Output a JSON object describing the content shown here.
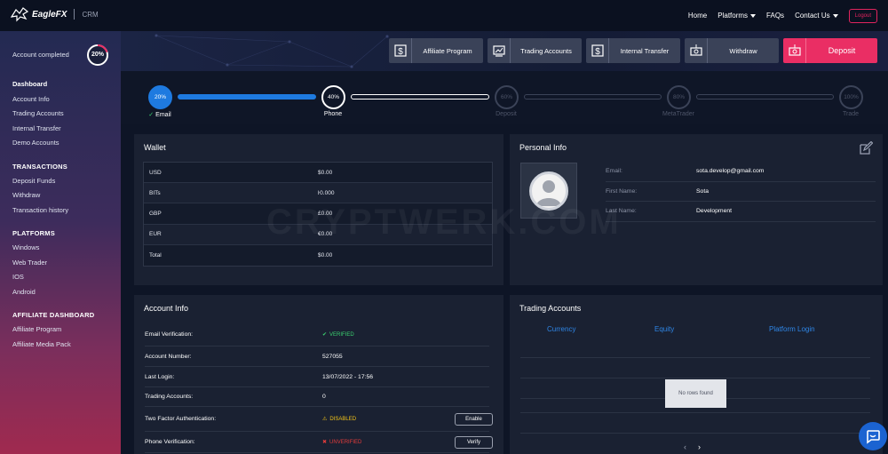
{
  "nav": {
    "brand": "EagleFX",
    "product": "CRM",
    "links": [
      {
        "label": "Home",
        "has_caret": false
      },
      {
        "label": "Platforms",
        "has_caret": true
      },
      {
        "label": "FAQs",
        "has_caret": false
      },
      {
        "label": "Contact Us",
        "has_caret": true
      }
    ],
    "logout_label": "Logout"
  },
  "sidebar": {
    "account_completed_label": "Account completed",
    "account_completed_pct": "20%",
    "account_completed_value": 0.2,
    "groups": [
      {
        "heading": "",
        "items": [
          "Dashboard",
          "Account Info",
          "Trading Accounts",
          "Internal Transfer",
          "Demo Accounts"
        ]
      },
      {
        "heading": "TRANSACTIONS",
        "items": [
          "Deposit Funds",
          "Withdraw",
          "Transaction history"
        ]
      },
      {
        "heading": "PLATFORMS",
        "items": [
          "Windows",
          "Web Trader",
          "IOS",
          "Android"
        ]
      },
      {
        "heading": "AFFILIATE DASHBOARD",
        "items": [
          "Affiliate Program",
          "Affiliate Media Pack"
        ]
      }
    ],
    "active_item": "Dashboard"
  },
  "quick_actions": [
    {
      "label": "Affiliate Program",
      "icon": "affiliate-icon"
    },
    {
      "label": "Trading Accounts",
      "icon": "trading-accounts-icon"
    },
    {
      "label": "Internal Transfer",
      "icon": "transfer-icon"
    },
    {
      "label": "Withdraw",
      "icon": "withdraw-icon"
    },
    {
      "label": "Deposit",
      "icon": "deposit-icon"
    }
  ],
  "steps": [
    {
      "pct": "20%",
      "label": "Email",
      "state": "done",
      "checked": true
    },
    {
      "pct": "40%",
      "label": "Phone",
      "state": "current",
      "checked": false
    },
    {
      "pct": "60%",
      "label": "Deposit",
      "state": "pending",
      "checked": false
    },
    {
      "pct": "80%",
      "label": "MetaTrader",
      "state": "pending",
      "checked": false
    },
    {
      "pct": "100%",
      "label": "Trade",
      "state": "pending",
      "checked": false
    }
  ],
  "watermark": "CRYPTWERK.COM",
  "wallet": {
    "title": "Wallet",
    "rows": [
      {
        "currency": "USD",
        "amount": "$0.00"
      },
      {
        "currency": "BITs",
        "amount": "ŀ0.000"
      },
      {
        "currency": "GBP",
        "amount": "£0.00"
      },
      {
        "currency": "EUR",
        "amount": "€0.00"
      },
      {
        "currency": "Total",
        "amount": "$0.00"
      }
    ]
  },
  "personal_info": {
    "title": "Personal Info",
    "rows": [
      {
        "label": "Email:",
        "value": "sota.develop@gmail.com"
      },
      {
        "label": "First Name:",
        "value": "Sota"
      },
      {
        "label": "Last Name:",
        "value": "Development"
      }
    ]
  },
  "account_info": {
    "title": "Account Info",
    "rows": [
      {
        "label": "Email Verification:",
        "value": "VERIFIED",
        "status": "verified",
        "button": ""
      },
      {
        "label": "Account Number:",
        "value": "527055",
        "status": "",
        "button": ""
      },
      {
        "label": "Last Login:",
        "value": "13/07/2022 - 17:56",
        "status": "",
        "button": ""
      },
      {
        "label": "Trading Accounts:",
        "value": "0",
        "status": "",
        "button": ""
      },
      {
        "label": "Two Factor Authentication:",
        "value": "DISABLED",
        "status": "disabled",
        "button": "Enable"
      },
      {
        "label": "Phone Verification:",
        "value": "UNVERIFIED",
        "status": "unverified",
        "button": "Verify"
      }
    ]
  },
  "trading_accounts": {
    "title": "Trading Accounts",
    "columns": [
      "Currency",
      "Equity",
      "Platform Login"
    ],
    "empty_text": "No rows found",
    "prev": "‹",
    "next": "›"
  },
  "colors": {
    "accent_blue": "#1e7ae0",
    "deposit_pink": "#ea2e64",
    "verified_green": "#3bd16f",
    "disabled_yellow": "#f5c518",
    "unverified_red": "#e23b3b"
  }
}
